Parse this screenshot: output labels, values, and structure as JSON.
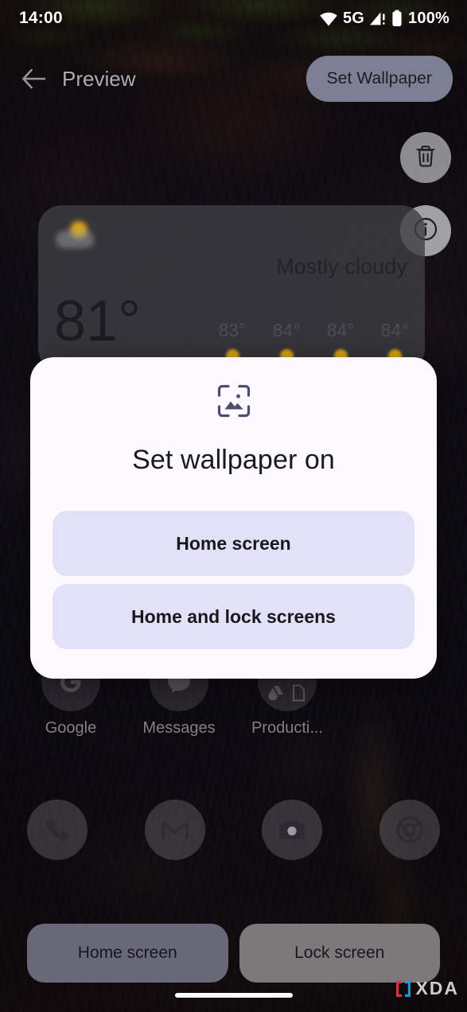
{
  "status_bar": {
    "time": "14:00",
    "network_label": "5G",
    "battery_label": "100%",
    "icons": [
      "wifi-icon",
      "cellular-signal-alert-icon",
      "battery-full-icon"
    ]
  },
  "app_bar": {
    "back_icon": "back-arrow-icon",
    "title": "Preview",
    "set_wallpaper_label": "Set Wallpaper"
  },
  "actions": {
    "delete_icon": "trash-icon",
    "info_icon": "info-icon"
  },
  "weather_widget": {
    "condition": "Mostly cloudy",
    "current_temp": "81°",
    "forecast": [
      "83°",
      "84°",
      "84°",
      "84°"
    ],
    "icon": "sun-behind-cloud-icon"
  },
  "launcher": {
    "apps": [
      {
        "label": "Google",
        "icon": "google-icon"
      },
      {
        "label": "Messages",
        "icon": "messages-icon"
      },
      {
        "label": "Producti...",
        "icon": "productivity-folder-icon"
      }
    ],
    "dock": [
      {
        "icon": "phone-icon"
      },
      {
        "icon": "gmail-icon"
      },
      {
        "icon": "camera-icon"
      },
      {
        "icon": "chrome-icon"
      }
    ]
  },
  "screen_tabs": {
    "home_label": "Home screen",
    "lock_label": "Lock screen",
    "selected": "Home screen"
  },
  "dialog": {
    "icon": "wallpaper-image-icon",
    "title": "Set wallpaper on",
    "options": [
      {
        "label": "Home screen"
      },
      {
        "label": "Home and lock screens"
      }
    ]
  },
  "watermark": {
    "text": "XDA"
  },
  "colors": {
    "dialog_bg": "#FCFAFF",
    "option_bg": "#E3E1F7",
    "icon_accent": "#4F4C72",
    "set_wallpaper_bg": "#7D7F94",
    "widget_bg": "rgba(62,62,68,0.80)",
    "accent_sun": "#D4A214"
  }
}
